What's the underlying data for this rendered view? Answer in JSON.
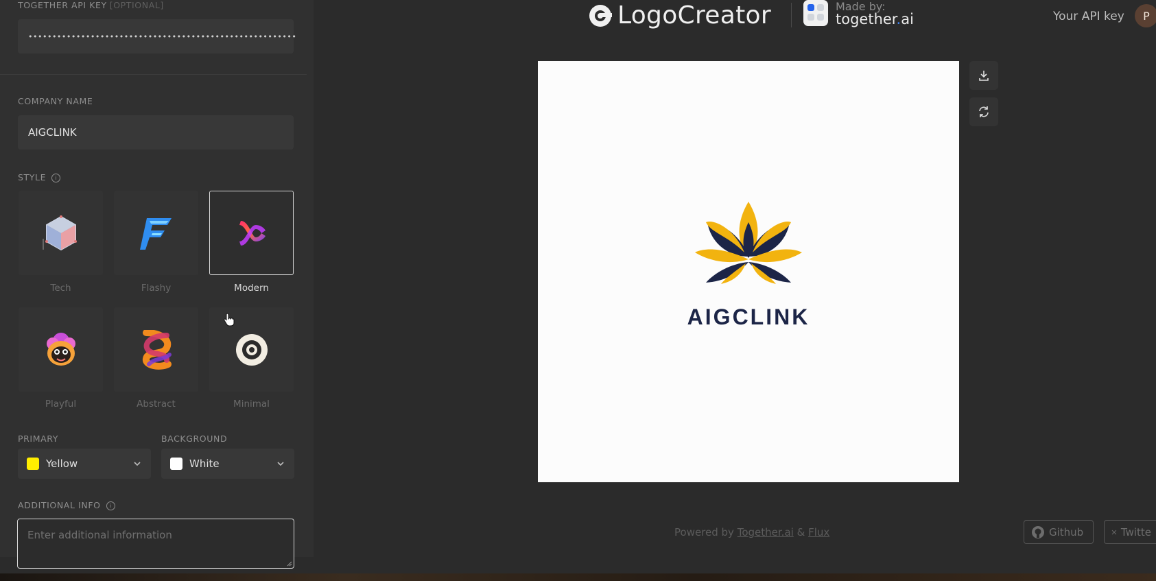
{
  "sidebar": {
    "api_key": {
      "label": "TOGETHER API KEY",
      "optional_tag": "[OPTIONAL]",
      "value": "••••••••••••••••••••••••••••••••••••••••••••••••••••••••"
    },
    "company": {
      "label": "COMPANY NAME",
      "value": "AIGCLINK"
    },
    "style": {
      "label": "STYLE",
      "selected": "Modern",
      "options": [
        {
          "name": "Tech",
          "icon": "tech-cube-icon"
        },
        {
          "name": "Flashy",
          "icon": "flashy-f-icon"
        },
        {
          "name": "Modern",
          "icon": "modern-ribbon-icon"
        },
        {
          "name": "Playful",
          "icon": "playful-mascot-icon"
        },
        {
          "name": "Abstract",
          "icon": "abstract-knot-icon"
        },
        {
          "name": "Minimal",
          "icon": "minimal-circle-icon"
        }
      ]
    },
    "primary": {
      "label": "PRIMARY",
      "value": "Yellow",
      "color": "#ffee00"
    },
    "background": {
      "label": "BACKGROUND",
      "value": "White",
      "color": "#ffffff"
    },
    "additional_info": {
      "label": "ADDITIONAL INFO",
      "placeholder": "Enter additional information"
    }
  },
  "header": {
    "app_name": "LogoCreator",
    "made_by_label": "Made by:",
    "made_by_name_pre": "together",
    "made_by_dot": ".",
    "made_by_name_post": "ai",
    "api_key_link": "Your API key",
    "avatar_initial": "P"
  },
  "preview": {
    "logo_text": "AIGCLINK",
    "colors": {
      "navy": "#1c2547",
      "gold": "#f2b30f"
    }
  },
  "footer": {
    "powered_by": "Powered by",
    "together_link": "Together.ai",
    "amp": "&",
    "flux_link": "Flux",
    "github": "Github",
    "twitter": "Twitte"
  }
}
